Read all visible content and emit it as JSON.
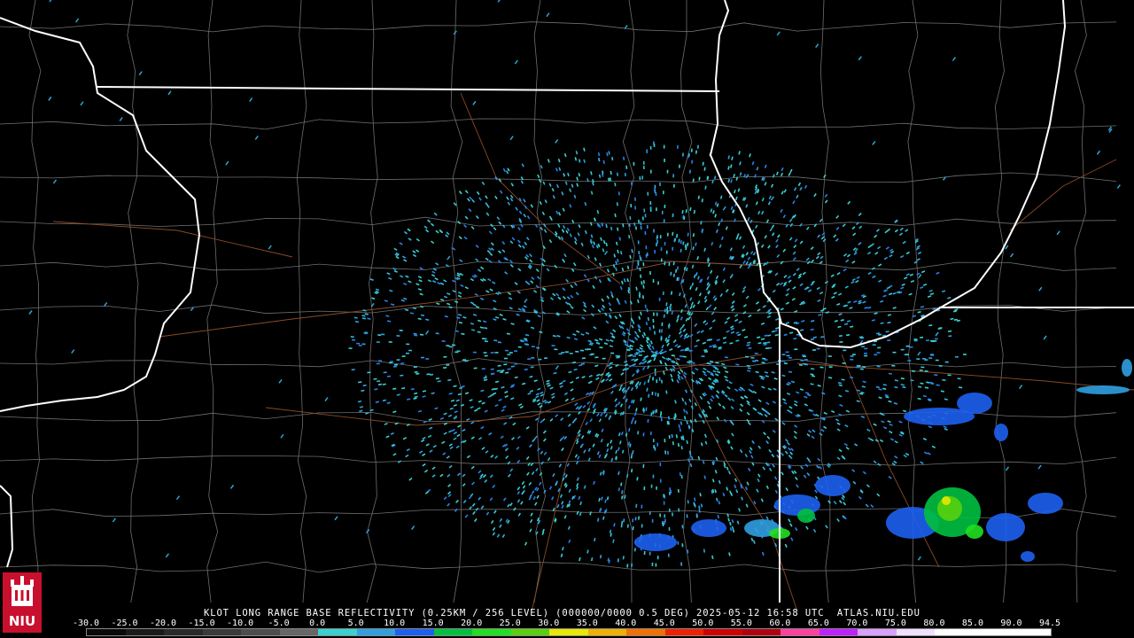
{
  "caption": "KLOT LONG RANGE BASE REFLECTIVITY (0.25KM / 256 LEVEL) (000000/0000 0.5 DEG) 2025-05-12 16:58 UTC  ATLAS.NIU.EDU",
  "logo": {
    "text": "NIU",
    "icon": "niu-castle-logo",
    "bg_color": "#c8102e"
  },
  "scale": {
    "labels": [
      "-30.0",
      "-25.0",
      "-20.0",
      "-15.0",
      "-10.0",
      "-5.0",
      "0.0",
      "5.0",
      "10.0",
      "15.0",
      "20.0",
      "25.0",
      "30.0",
      "35.0",
      "40.0",
      "45.0",
      "50.0",
      "55.0",
      "60.0",
      "65.0",
      "70.0",
      "75.0",
      "80.0",
      "85.0",
      "90.0",
      "94.5"
    ],
    "colors": [
      "#0a0a0a",
      "#1a1a1a",
      "#2a2a2a",
      "#3a3a3a",
      "#4d4d4d",
      "#666666",
      "#3ad0d0",
      "#2f9fe0",
      "#1d60f0",
      "#00c040",
      "#20e020",
      "#58d010",
      "#e8e800",
      "#f0b000",
      "#f07000",
      "#f02000",
      "#d00000",
      "#b00010",
      "#ff40a0",
      "#c020ff",
      "#d8a0ff",
      "#f0e0ff",
      "#ffffff",
      "#ffffff",
      "#ffffff"
    ]
  }
}
